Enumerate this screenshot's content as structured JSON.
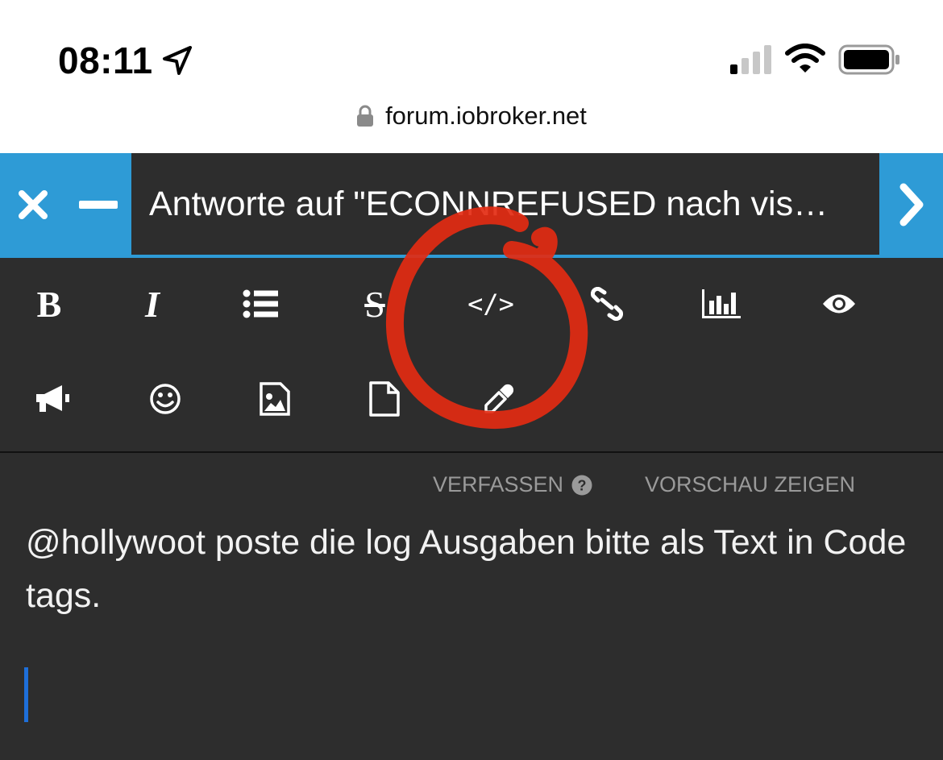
{
  "status_bar": {
    "time": "08:11",
    "url": "forum.iobroker.net",
    "icons": [
      "location-arrow-icon",
      "signal-icon",
      "wifi-icon",
      "battery-icon",
      "lock-icon"
    ]
  },
  "composer": {
    "title": "Antworte auf \"ECONNREFUSED nach vis…",
    "accent_color": "#2e9bd6",
    "background_color": "#2d2d2d",
    "buttons": [
      "close-icon",
      "minimize-icon",
      "submit-chevron-icon"
    ]
  },
  "toolbar": {
    "row1": [
      {
        "name": "bold",
        "glyph": "B"
      },
      {
        "name": "italic",
        "glyph": "I"
      },
      {
        "name": "list",
        "icon": "list-icon"
      },
      {
        "name": "strikethrough",
        "glyph": "S"
      },
      {
        "name": "code",
        "glyph": "</>"
      },
      {
        "name": "link",
        "icon": "link-icon"
      },
      {
        "name": "poll",
        "icon": "bar-chart-icon"
      },
      {
        "name": "preview",
        "icon": "eye-icon"
      }
    ],
    "row2": [
      {
        "name": "announce",
        "icon": "megaphone-icon"
      },
      {
        "name": "emoji",
        "icon": "smiley-icon"
      },
      {
        "name": "image",
        "icon": "image-icon"
      },
      {
        "name": "file",
        "icon": "file-icon"
      },
      {
        "name": "spoiler",
        "icon": "eyedropper-icon"
      }
    ]
  },
  "tabs": {
    "compose": "VERFASSEN",
    "preview": "VORSCHAU ZEIGEN"
  },
  "editor": {
    "text": "@hollywoot poste die log Ausgaben bitte als Text in Code tags.",
    "caret_color": "#1e6fd9"
  },
  "annotation": {
    "shape": "hand-drawn circle",
    "color": "#e32b12",
    "target": "code"
  }
}
